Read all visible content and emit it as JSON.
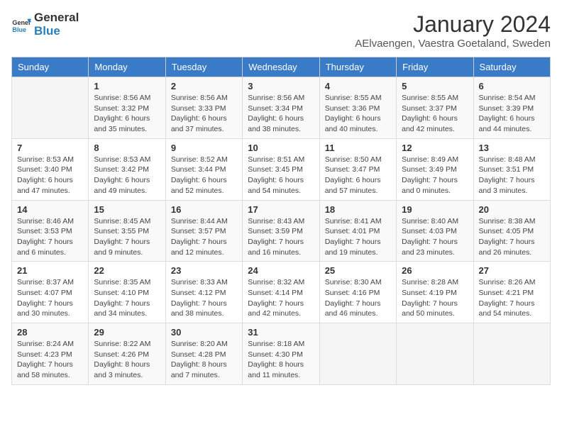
{
  "header": {
    "logo_general": "General",
    "logo_blue": "Blue",
    "month_title": "January 2024",
    "subtitle": "AElvaengen, Vaestra Goetaland, Sweden"
  },
  "days_of_week": [
    "Sunday",
    "Monday",
    "Tuesday",
    "Wednesday",
    "Thursday",
    "Friday",
    "Saturday"
  ],
  "weeks": [
    [
      {
        "day": "",
        "sunrise": "",
        "sunset": "",
        "daylight": ""
      },
      {
        "day": "1",
        "sunrise": "Sunrise: 8:56 AM",
        "sunset": "Sunset: 3:32 PM",
        "daylight": "Daylight: 6 hours and 35 minutes."
      },
      {
        "day": "2",
        "sunrise": "Sunrise: 8:56 AM",
        "sunset": "Sunset: 3:33 PM",
        "daylight": "Daylight: 6 hours and 37 minutes."
      },
      {
        "day": "3",
        "sunrise": "Sunrise: 8:56 AM",
        "sunset": "Sunset: 3:34 PM",
        "daylight": "Daylight: 6 hours and 38 minutes."
      },
      {
        "day": "4",
        "sunrise": "Sunrise: 8:55 AM",
        "sunset": "Sunset: 3:36 PM",
        "daylight": "Daylight: 6 hours and 40 minutes."
      },
      {
        "day": "5",
        "sunrise": "Sunrise: 8:55 AM",
        "sunset": "Sunset: 3:37 PM",
        "daylight": "Daylight: 6 hours and 42 minutes."
      },
      {
        "day": "6",
        "sunrise": "Sunrise: 8:54 AM",
        "sunset": "Sunset: 3:39 PM",
        "daylight": "Daylight: 6 hours and 44 minutes."
      }
    ],
    [
      {
        "day": "7",
        "sunrise": "Sunrise: 8:53 AM",
        "sunset": "Sunset: 3:40 PM",
        "daylight": "Daylight: 6 hours and 47 minutes."
      },
      {
        "day": "8",
        "sunrise": "Sunrise: 8:53 AM",
        "sunset": "Sunset: 3:42 PM",
        "daylight": "Daylight: 6 hours and 49 minutes."
      },
      {
        "day": "9",
        "sunrise": "Sunrise: 8:52 AM",
        "sunset": "Sunset: 3:44 PM",
        "daylight": "Daylight: 6 hours and 52 minutes."
      },
      {
        "day": "10",
        "sunrise": "Sunrise: 8:51 AM",
        "sunset": "Sunset: 3:45 PM",
        "daylight": "Daylight: 6 hours and 54 minutes."
      },
      {
        "day": "11",
        "sunrise": "Sunrise: 8:50 AM",
        "sunset": "Sunset: 3:47 PM",
        "daylight": "Daylight: 6 hours and 57 minutes."
      },
      {
        "day": "12",
        "sunrise": "Sunrise: 8:49 AM",
        "sunset": "Sunset: 3:49 PM",
        "daylight": "Daylight: 7 hours and 0 minutes."
      },
      {
        "day": "13",
        "sunrise": "Sunrise: 8:48 AM",
        "sunset": "Sunset: 3:51 PM",
        "daylight": "Daylight: 7 hours and 3 minutes."
      }
    ],
    [
      {
        "day": "14",
        "sunrise": "Sunrise: 8:46 AM",
        "sunset": "Sunset: 3:53 PM",
        "daylight": "Daylight: 7 hours and 6 minutes."
      },
      {
        "day": "15",
        "sunrise": "Sunrise: 8:45 AM",
        "sunset": "Sunset: 3:55 PM",
        "daylight": "Daylight: 7 hours and 9 minutes."
      },
      {
        "day": "16",
        "sunrise": "Sunrise: 8:44 AM",
        "sunset": "Sunset: 3:57 PM",
        "daylight": "Daylight: 7 hours and 12 minutes."
      },
      {
        "day": "17",
        "sunrise": "Sunrise: 8:43 AM",
        "sunset": "Sunset: 3:59 PM",
        "daylight": "Daylight: 7 hours and 16 minutes."
      },
      {
        "day": "18",
        "sunrise": "Sunrise: 8:41 AM",
        "sunset": "Sunset: 4:01 PM",
        "daylight": "Daylight: 7 hours and 19 minutes."
      },
      {
        "day": "19",
        "sunrise": "Sunrise: 8:40 AM",
        "sunset": "Sunset: 4:03 PM",
        "daylight": "Daylight: 7 hours and 23 minutes."
      },
      {
        "day": "20",
        "sunrise": "Sunrise: 8:38 AM",
        "sunset": "Sunset: 4:05 PM",
        "daylight": "Daylight: 7 hours and 26 minutes."
      }
    ],
    [
      {
        "day": "21",
        "sunrise": "Sunrise: 8:37 AM",
        "sunset": "Sunset: 4:07 PM",
        "daylight": "Daylight: 7 hours and 30 minutes."
      },
      {
        "day": "22",
        "sunrise": "Sunrise: 8:35 AM",
        "sunset": "Sunset: 4:10 PM",
        "daylight": "Daylight: 7 hours and 34 minutes."
      },
      {
        "day": "23",
        "sunrise": "Sunrise: 8:33 AM",
        "sunset": "Sunset: 4:12 PM",
        "daylight": "Daylight: 7 hours and 38 minutes."
      },
      {
        "day": "24",
        "sunrise": "Sunrise: 8:32 AM",
        "sunset": "Sunset: 4:14 PM",
        "daylight": "Daylight: 7 hours and 42 minutes."
      },
      {
        "day": "25",
        "sunrise": "Sunrise: 8:30 AM",
        "sunset": "Sunset: 4:16 PM",
        "daylight": "Daylight: 7 hours and 46 minutes."
      },
      {
        "day": "26",
        "sunrise": "Sunrise: 8:28 AM",
        "sunset": "Sunset: 4:19 PM",
        "daylight": "Daylight: 7 hours and 50 minutes."
      },
      {
        "day": "27",
        "sunrise": "Sunrise: 8:26 AM",
        "sunset": "Sunset: 4:21 PM",
        "daylight": "Daylight: 7 hours and 54 minutes."
      }
    ],
    [
      {
        "day": "28",
        "sunrise": "Sunrise: 8:24 AM",
        "sunset": "Sunset: 4:23 PM",
        "daylight": "Daylight: 7 hours and 58 minutes."
      },
      {
        "day": "29",
        "sunrise": "Sunrise: 8:22 AM",
        "sunset": "Sunset: 4:26 PM",
        "daylight": "Daylight: 8 hours and 3 minutes."
      },
      {
        "day": "30",
        "sunrise": "Sunrise: 8:20 AM",
        "sunset": "Sunset: 4:28 PM",
        "daylight": "Daylight: 8 hours and 7 minutes."
      },
      {
        "day": "31",
        "sunrise": "Sunrise: 8:18 AM",
        "sunset": "Sunset: 4:30 PM",
        "daylight": "Daylight: 8 hours and 11 minutes."
      },
      {
        "day": "",
        "sunrise": "",
        "sunset": "",
        "daylight": ""
      },
      {
        "day": "",
        "sunrise": "",
        "sunset": "",
        "daylight": ""
      },
      {
        "day": "",
        "sunrise": "",
        "sunset": "",
        "daylight": ""
      }
    ]
  ]
}
